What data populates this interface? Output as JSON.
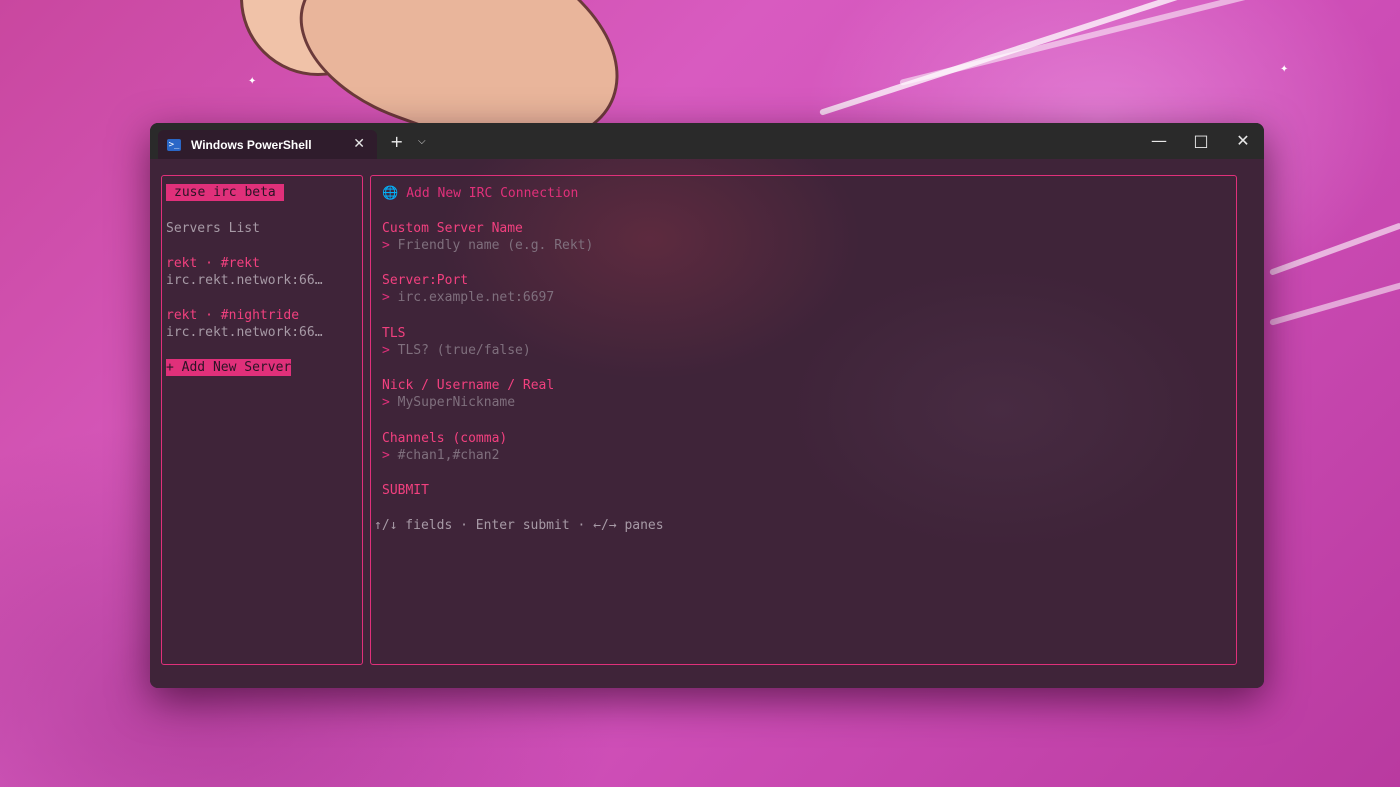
{
  "window": {
    "tab_title": "Windows PowerShell",
    "tab_icon": "powershell-icon",
    "new_tab_icon": "+",
    "dropdown_icon": "chevron-down-icon",
    "controls": [
      "minimize-icon",
      "maximize-icon",
      "close-icon"
    ]
  },
  "colors": {
    "accent": "#e0307a",
    "text_muted": "#a79aa6",
    "placeholder": "#7f6f7d",
    "background": "#3f2439"
  },
  "sidebar": {
    "app_badge": "zuse irc beta",
    "heading": "Servers List",
    "servers": [
      {
        "name": "rekt · #rekt",
        "host": "irc.rekt.network:66…"
      },
      {
        "name": "rekt · #nightride",
        "host": "irc.rekt.network:66…"
      }
    ],
    "add_button": "+ Add New Server"
  },
  "form": {
    "title": "Add New IRC Connection",
    "title_icon": "globe-icon",
    "prompt": ">",
    "fields": [
      {
        "label": "Custom Server Name",
        "placeholder": "Friendly name (e.g. Rekt)"
      },
      {
        "label": "Server:Port",
        "placeholder": "irc.example.net:6697"
      },
      {
        "label": "TLS",
        "placeholder": "TLS? (true/false)"
      },
      {
        "label": "Nick / Username / Real",
        "placeholder": "MySuperNickname"
      },
      {
        "label": "Channels (comma)",
        "placeholder": "#chan1,#chan2"
      }
    ],
    "submit_label": "SUBMIT",
    "help": "↑/↓ fields · Enter submit · ←/→ panes"
  }
}
